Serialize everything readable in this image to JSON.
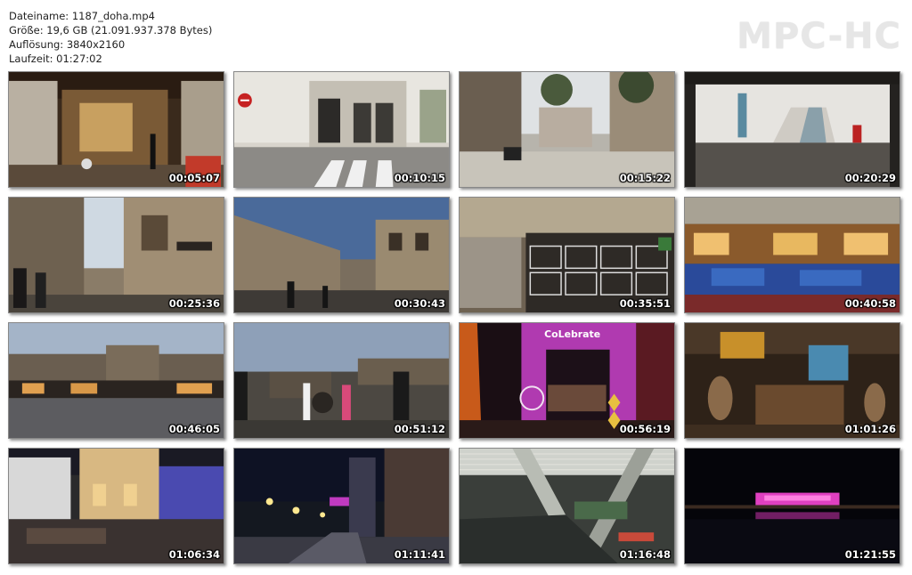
{
  "file_info": {
    "name": "Dateiname: 1187_doha.mp4",
    "size": "Größe: 19,6 GB (21.091.937.378 Bytes)",
    "resolution": "Auflösung: 3840x2160",
    "duration": "Laufzeit: 01:27:02"
  },
  "logo": "MPC-HC",
  "thumbnails": [
    {
      "timestamp": "00:05:07",
      "scene": "souq-arcade-day"
    },
    {
      "timestamp": "00:10:15",
      "scene": "street-crosswalk"
    },
    {
      "timestamp": "00:15:22",
      "scene": "plaza-palms"
    },
    {
      "timestamp": "00:20:29",
      "scene": "tunnel-stairs"
    },
    {
      "timestamp": "00:25:36",
      "scene": "souq-street-sky"
    },
    {
      "timestamp": "00:30:43",
      "scene": "souq-street-dusk"
    },
    {
      "timestamp": "00:35:51",
      "scene": "shop-cages"
    },
    {
      "timestamp": "00:40:58",
      "scene": "cafe-blue-seats"
    },
    {
      "timestamp": "00:46:05",
      "scene": "fort-evening"
    },
    {
      "timestamp": "00:51:12",
      "scene": "crowd-cannon"
    },
    {
      "timestamp": "00:56:19",
      "scene": "celebrate-arch"
    },
    {
      "timestamp": "01:01:26",
      "scene": "antique-shop-night"
    },
    {
      "timestamp": "01:06:34",
      "scene": "restaurant-night"
    },
    {
      "timestamp": "01:11:41",
      "scene": "street-lights-night"
    },
    {
      "timestamp": "01:16:48",
      "scene": "metro-station"
    },
    {
      "timestamp": "01:21:55",
      "scene": "waterfront-night"
    }
  ],
  "arch_text": "CoLebrate"
}
